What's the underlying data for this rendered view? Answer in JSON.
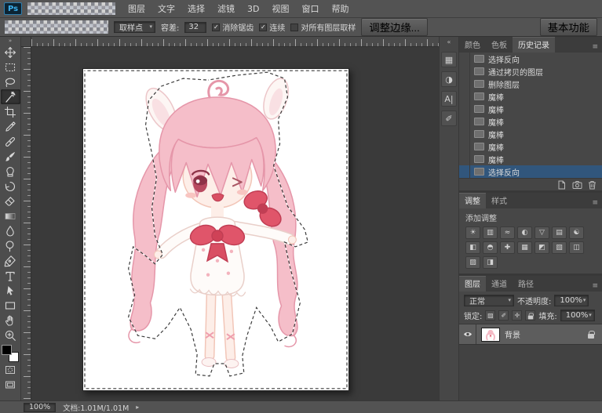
{
  "window": {
    "logo": "Ps"
  },
  "menu": {
    "items": [
      {
        "label": "图层"
      },
      {
        "label": "文字"
      },
      {
        "label": "选择"
      },
      {
        "label": "滤镜"
      },
      {
        "label": "3D"
      },
      {
        "label": "视图"
      },
      {
        "label": "窗口"
      },
      {
        "label": "帮助"
      }
    ]
  },
  "options": {
    "sample_size": {
      "label": "取样点"
    },
    "tolerance": {
      "label": "容差:",
      "value": "32"
    },
    "antialias": {
      "label": "消除锯齿",
      "check": "✓"
    },
    "contiguous": {
      "label": "连续",
      "check": "✓"
    },
    "sample_all": {
      "label": "对所有图层取样",
      "check": ""
    },
    "refine_edge": {
      "label": "调整边缘..."
    },
    "workspace": {
      "label": "基本功能"
    }
  },
  "toolbar": {
    "collapse_glyph": "»",
    "tools": [
      "move",
      "rectangular-marquee",
      "lasso",
      "magic-wand",
      "crop",
      "eyedropper",
      "spot-healing",
      "brush",
      "clone-stamp",
      "history-brush",
      "eraser",
      "gradient",
      "blur",
      "dodge",
      "pen",
      "type",
      "path-selection",
      "shape",
      "hand",
      "zoom"
    ],
    "active_tool": "magic-wand",
    "foreground_color": "#000000",
    "background_color": "#ffffff"
  },
  "dock_strip": {
    "collapse_glyph": "«",
    "icons": [
      {
        "name": "swatches-panel",
        "glyph": "▦"
      },
      {
        "name": "adjustments-panel",
        "glyph": "◑"
      },
      {
        "name": "character-panel",
        "glyph": "A|"
      },
      {
        "name": "brush-panel",
        "glyph": "✐"
      }
    ]
  },
  "history_panel": {
    "tabs": [
      {
        "label": "颜色"
      },
      {
        "label": "色板"
      },
      {
        "label": "历史记录"
      }
    ],
    "active_tab": "历史记录",
    "menu_icon": "≡",
    "items": [
      {
        "label": "选择反向"
      },
      {
        "label": "通过拷贝的图层"
      },
      {
        "label": "删除图层"
      },
      {
        "label": "魔棒"
      },
      {
        "label": "魔棒"
      },
      {
        "label": "魔棒"
      },
      {
        "label": "魔棒"
      },
      {
        "label": "魔棒"
      },
      {
        "label": "魔棒"
      },
      {
        "label": "选择反向",
        "selected": true
      }
    ]
  },
  "adjustments_panel": {
    "tabs": [
      {
        "label": "调整"
      },
      {
        "label": "样式"
      }
    ],
    "active_tab": "调整",
    "title": "添加调整",
    "icons": [
      {
        "name": "brightness-contrast",
        "glyph": "☀"
      },
      {
        "name": "levels",
        "glyph": "▥"
      },
      {
        "name": "curves",
        "glyph": "≈"
      },
      {
        "name": "exposure",
        "glyph": "◐"
      },
      {
        "name": "vibrance",
        "glyph": "▽"
      },
      {
        "name": "hue-saturation",
        "glyph": "▤"
      },
      {
        "name": "color-balance",
        "glyph": "☯"
      },
      {
        "name": "black-white",
        "glyph": "◧"
      },
      {
        "name": "photo-filter",
        "glyph": "◓"
      },
      {
        "name": "channel-mixer",
        "glyph": "✚"
      },
      {
        "name": "color-lookup",
        "glyph": "▦"
      },
      {
        "name": "invert",
        "glyph": "◩"
      },
      {
        "name": "posterize",
        "glyph": "▧"
      },
      {
        "name": "threshold",
        "glyph": "◫"
      },
      {
        "name": "gradient-map",
        "glyph": "▨"
      },
      {
        "name": "selective-color",
        "glyph": "◨"
      }
    ]
  },
  "layers_panel": {
    "tabs": [
      {
        "label": "图层"
      },
      {
        "label": "通道"
      },
      {
        "label": "路径"
      }
    ],
    "active_tab": "图层",
    "menu_icon": "≡",
    "blend_mode": "正常",
    "opacity_label": "不透明度:",
    "opacity_value": "100%",
    "lock_label": "锁定:",
    "lock_icons": [
      {
        "name": "lock-transparent-pixels",
        "glyph": "▨"
      },
      {
        "name": "lock-image-pixels",
        "glyph": "✐"
      },
      {
        "name": "lock-position",
        "glyph": "✛"
      },
      {
        "name": "lock-all",
        "glyph": ""
      }
    ],
    "fill_label": "填充:",
    "fill_value": "100%",
    "layers": [
      {
        "name": "背景",
        "locked": true,
        "visible": true
      }
    ]
  },
  "status_bar": {
    "zoom": "100%",
    "doc_info": "文档:1.01M/1.01M",
    "expander": "▸"
  }
}
